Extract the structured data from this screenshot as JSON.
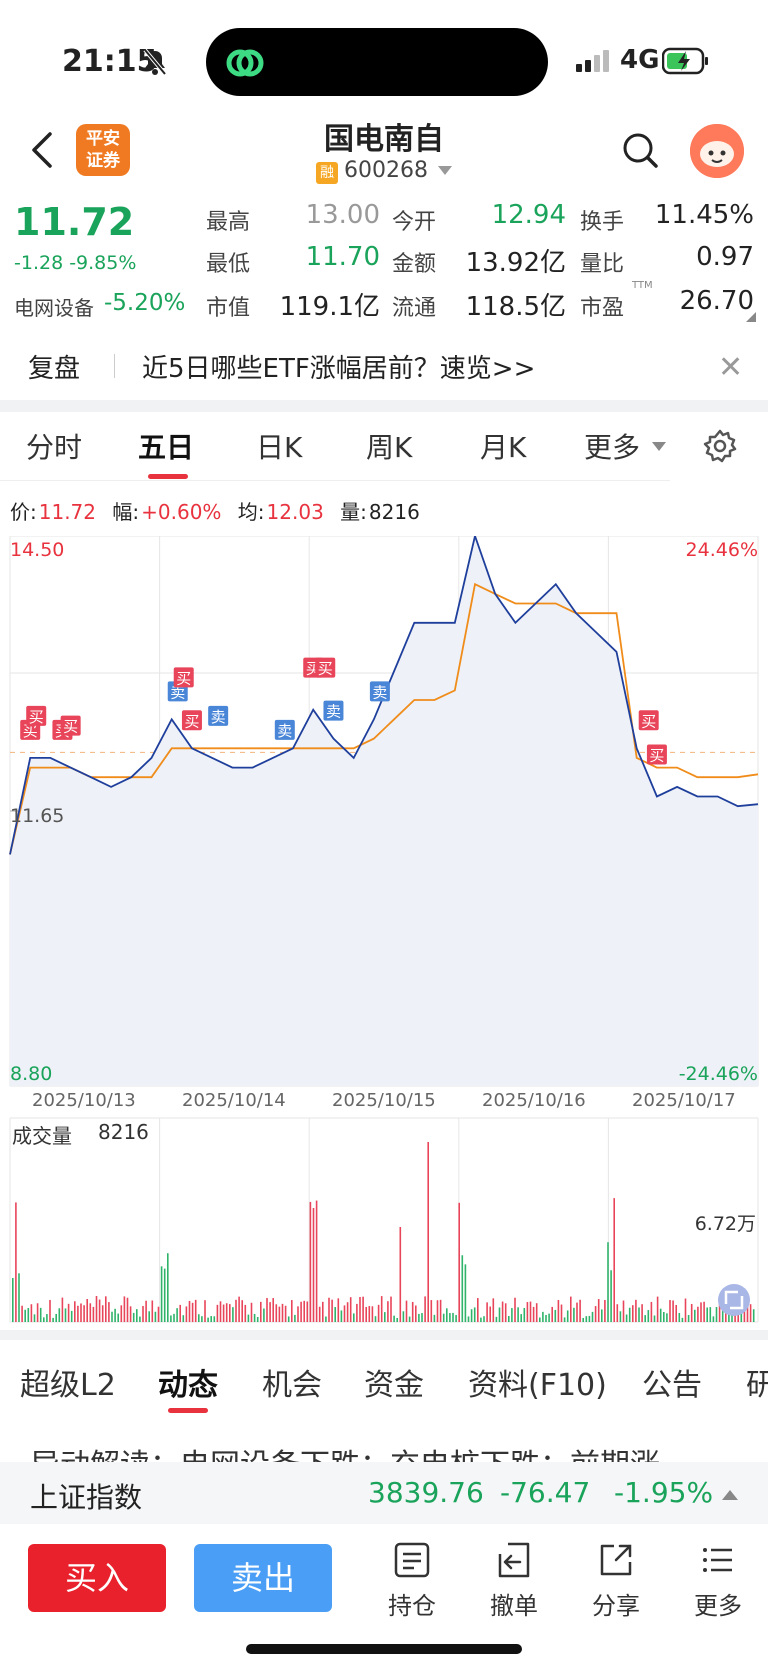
{
  "status_bar": {
    "time": "21:15",
    "network": "4G"
  },
  "header": {
    "broker_logo": "平安\n证券",
    "stock_name": "国电南自",
    "badge": "融",
    "code": "600268"
  },
  "quote": {
    "price": "11.72",
    "change": "-1.28 -9.85%",
    "sector_name": "电网设备",
    "sector_change": "-5.20%",
    "fields": [
      {
        "label": "最高",
        "value": "13.00",
        "color": "#999999"
      },
      {
        "label": "今开",
        "value": "12.94",
        "color": "#1aa35a"
      },
      {
        "label": "换手",
        "value": "11.45%",
        "color": "#222222"
      },
      {
        "label": "最低",
        "value": "11.70",
        "color": "#1aa35a"
      },
      {
        "label": "金额",
        "value": "13.92亿",
        "color": "#222222"
      },
      {
        "label": "量比",
        "value": "0.97",
        "color": "#222222"
      },
      {
        "label": "市值",
        "value": "119.1亿",
        "color": "#222222"
      },
      {
        "label": "流通",
        "value": "118.5亿",
        "color": "#222222"
      },
      {
        "label": "市盈",
        "value": "26.70",
        "color": "#222222"
      }
    ],
    "pe_suffix": "TTM"
  },
  "banner": {
    "replay_label": "复盘",
    "text": "近5日哪些ETF涨幅居前？速览>>"
  },
  "chart_tabs": [
    "分时",
    "五日",
    "日K",
    "周K",
    "月K",
    "更多"
  ],
  "info_line": {
    "price_label": "价:",
    "price": "11.72",
    "amp_label": "幅:",
    "amp": "+0.60%",
    "avg_label": "均:",
    "avg": "12.03",
    "vol_label": "量:",
    "vol": "8216"
  },
  "chart_data": {
    "type": "line",
    "y_max_label": "14.50",
    "y_min_label": "8.80",
    "y_mid_label": "11.65",
    "pct_max_label": "24.46%",
    "pct_min_label": "-24.46%",
    "ylim": [
      8.8,
      14.5
    ],
    "prev_close": 11.65,
    "dates": [
      "2025/10/13",
      "2025/10/14",
      "2025/10/15",
      "2025/10/16",
      "2025/10/17"
    ],
    "series": [
      {
        "values": [
          11.2,
          12.2,
          12.2,
          12.1,
          12.0,
          11.9,
          12.0,
          12.2,
          12.6,
          12.3,
          12.2,
          12.1,
          12.1,
          12.2,
          12.3,
          12.7,
          12.4,
          12.2,
          12.6,
          13.1,
          13.6,
          13.6,
          13.6,
          14.5,
          13.9,
          13.6,
          13.8,
          14.0,
          13.7,
          13.5,
          13.3,
          12.3,
          11.8,
          11.9,
          11.8,
          11.8,
          11.7,
          11.72
        ],
        "color": "#1f3f9c"
      },
      {
        "values": [
          11.2,
          12.1,
          12.1,
          12.1,
          12.0,
          12.0,
          12.0,
          12.0,
          12.3,
          12.3,
          12.3,
          12.3,
          12.3,
          12.3,
          12.3,
          12.3,
          12.3,
          12.3,
          12.4,
          12.6,
          12.8,
          12.8,
          12.9,
          14.0,
          13.9,
          13.8,
          13.8,
          13.8,
          13.7,
          13.7,
          13.7,
          12.2,
          12.1,
          12.1,
          12.0,
          12.0,
          12.0,
          12.03
        ],
        "color": "#f08c1a"
      }
    ],
    "markers": [
      "买",
      "买",
      "买",
      "买",
      "卖",
      "买",
      "买",
      "卖",
      "卖",
      "买",
      "卖",
      "买",
      "卖",
      "卖",
      "买",
      "买"
    ],
    "volume_label": "成交量",
    "volume_value": "8216",
    "volume_max_label": "6.72万"
  },
  "info_tabs": [
    "超级L2",
    "动态",
    "机会",
    "资金",
    "资料(F10)",
    "公告",
    "研"
  ],
  "news_line": "异动解读：电网设备下跌；充电桩下跌；前期涨",
  "index_strip": {
    "name": "上证指数",
    "value": "3839.76",
    "change": "-76.47",
    "pct": "-1.95%"
  },
  "actions": {
    "buy": "买入",
    "sell": "卖出",
    "items": [
      "持仓",
      "撤单",
      "分享",
      "更多"
    ]
  }
}
